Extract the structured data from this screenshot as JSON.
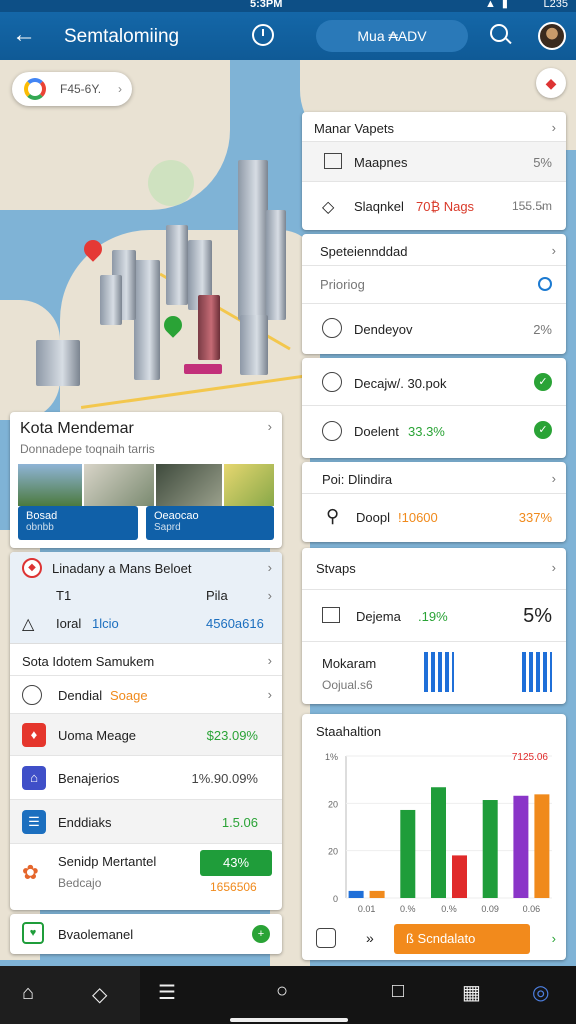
{
  "status_bar": {
    "time": "5:3PM",
    "right_text": "L235"
  },
  "app_bar": {
    "title": "Semtalomiing",
    "mode_pill": "Mua ₳ADV"
  },
  "map": {
    "search_chip": "F45-6Y."
  },
  "card_map_layers": {
    "title": "Manar Vapets",
    "rows": [
      {
        "label": "Maapnes",
        "value": "5%"
      },
      {
        "label": "Slaqnkel",
        "highlight": "70₿ Nags",
        "value": "15̵5.5̵m"
      }
    ]
  },
  "card_spe": {
    "title": "Speteiennddad",
    "rows": [
      {
        "label": "Prioriog"
      },
      {
        "label": "Dendeyov",
        "value": "2%"
      }
    ]
  },
  "card_status": {
    "rows": [
      {
        "label": "Decajw/. 30.pok"
      },
      {
        "label": "Doelent",
        "value": "33.3%"
      }
    ]
  },
  "card_poi": {
    "title": "Poi: Dlindira",
    "rows": [
      {
        "label": "Doopl",
        "value_mid": "!10600",
        "value": "337%"
      }
    ]
  },
  "card_stvaps": {
    "title": "Stvaps",
    "rows": [
      {
        "label": "Dejema",
        "value_mid": ".19%",
        "value": "5%"
      },
      {
        "label": "Mokaram",
        "sub": "Oojual.s6"
      }
    ]
  },
  "card_chart": {
    "title": "Staahaltion",
    "button_label": "ß Scndalato"
  },
  "chart_data": {
    "type": "bar",
    "ylabel": "",
    "y_ticks": [
      "1%",
      "20",
      "20",
      "0"
    ],
    "categories": [
      "0.01",
      "0.%",
      "0.%",
      "0.09",
      "0.06"
    ],
    "value_label": "7125.06",
    "ylim": [
      0,
      1
    ],
    "series": [
      {
        "color": "#1f6fd8",
        "values": [
          0.05,
          0,
          0,
          0,
          0
        ]
      },
      {
        "color": "#f08a1c",
        "values": [
          0.05,
          0,
          0,
          0,
          0
        ]
      },
      {
        "color": "#1f9d3a",
        "values": [
          0,
          0.62,
          0.78,
          0.69,
          0
        ]
      },
      {
        "color": "#e02a2a",
        "values": [
          0,
          0,
          0.3,
          0,
          0
        ]
      },
      {
        "color": "#8a35c8",
        "values": [
          0,
          0,
          0,
          0,
          0.72
        ]
      },
      {
        "color": "#f08a1c",
        "values": [
          0,
          0,
          0,
          0,
          0.73
        ]
      }
    ]
  },
  "card_mendemar": {
    "title": "Kota Mendemar",
    "subtitle": "Donnadepe toqnaih tarris",
    "btn1": "Bosad",
    "btn1_sub": "obnbb",
    "btn2": "Oeaocao",
    "btn2_sub": "Saprd"
  },
  "card_left_list": {
    "header": {
      "title": "Linadany a Mans Beloet",
      "row1_left": "T1",
      "row1_right": "Pila",
      "row2_left": "Ioral",
      "row2_mid": "1lcio",
      "row2_right": "4560a616"
    },
    "section_title": "Sota Idotem Samukem",
    "rows": [
      {
        "label": "Dendial",
        "highlight": "Soage"
      },
      {
        "label": "Uoma Meage",
        "value": "$23.09%"
      },
      {
        "label": "Benajerios",
        "value": "1%.90.09%"
      },
      {
        "label": "Enddiaks",
        "value": "1.5.06"
      },
      {
        "label": "Senidp Mertantel",
        "sub": "Bedcajo",
        "badge": "43%",
        "value": "1656506"
      },
      {
        "label": "Bvaolemanel"
      }
    ]
  }
}
